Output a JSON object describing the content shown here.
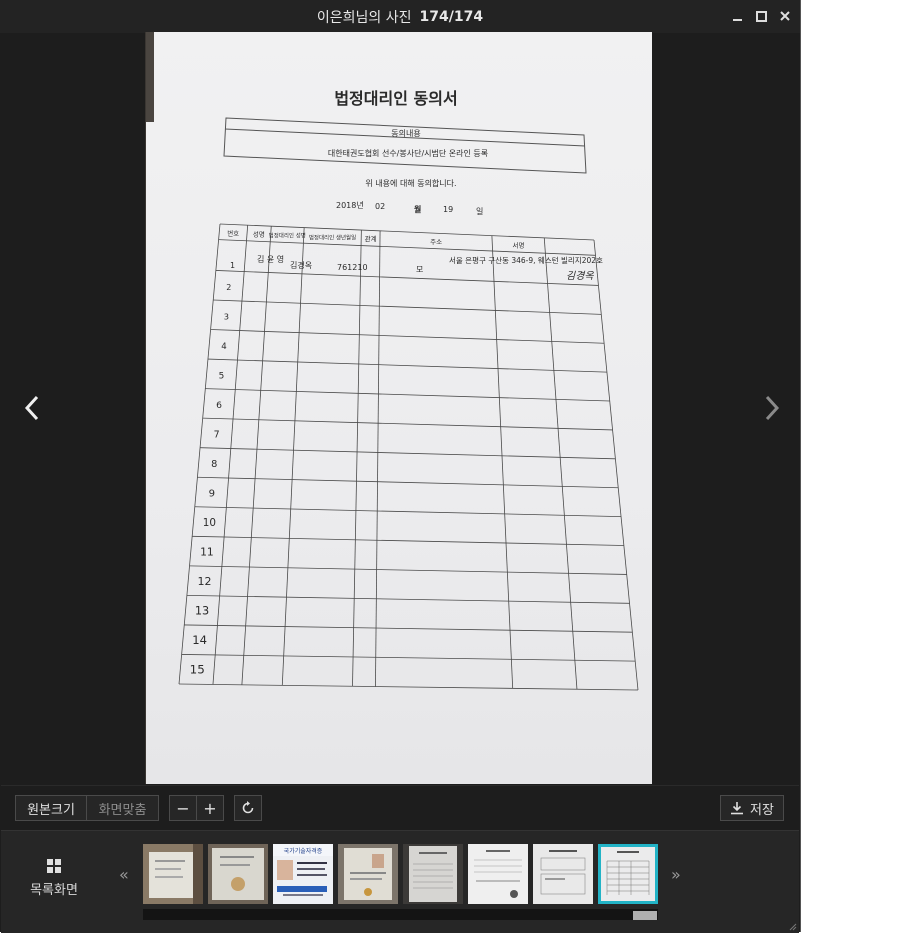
{
  "window": {
    "title": "이은희님의 사진",
    "counter": "174/174",
    "minimize_icon": "minimize-icon",
    "maximize_icon": "maximize-icon",
    "close_icon": "close-icon"
  },
  "document": {
    "heading": "법정대리인 동의서",
    "consent_label": "동의내용",
    "consent_text": "대한태권도협회 선수/봉사단/시범단 온라인 등록",
    "agree_text": "위 내용에 대해 동의합니다.",
    "date_year": "2018년",
    "date_month": "02",
    "date_month_unit": "월",
    "date_day": "19",
    "date_day_unit": "일",
    "table_headers": [
      "번호",
      "성명",
      "법정대리인 성명",
      "법정대리인 생년월일",
      "관계",
      "주소",
      "서명"
    ],
    "row1": {
      "no": "1",
      "name": "김 윤 영",
      "guardian": "김경옥",
      "birth": "761210",
      "relation": "모",
      "address": "서울 은평구 구산동 346-9, 웨스턴 빌리지202호",
      "signature": "김경옥"
    },
    "row_numbers": [
      "2",
      "3",
      "4",
      "5",
      "6",
      "7",
      "8",
      "9",
      "10",
      "11",
      "12",
      "13",
      "14",
      "15"
    ]
  },
  "toolbar": {
    "original_size_label": "원본크기",
    "fit_screen_label": "화면맞춤",
    "zoom_out_label": "−",
    "zoom_in_label": "+",
    "rotate_icon": "rotate-icon",
    "save_label": "저장",
    "save_icon": "download-icon"
  },
  "strip": {
    "list_label": "목록화면",
    "list_icon": "grid-icon",
    "prev_label": "«",
    "next_label": "»",
    "thumbnails": [
      {
        "name": "thumb-1",
        "selected": false
      },
      {
        "name": "thumb-2",
        "selected": false
      },
      {
        "name": "thumb-3",
        "caption": "국가기술자격증",
        "selected": false
      },
      {
        "name": "thumb-4",
        "selected": false
      },
      {
        "name": "thumb-5",
        "selected": false
      },
      {
        "name": "thumb-6",
        "selected": false
      },
      {
        "name": "thumb-7",
        "selected": false
      },
      {
        "name": "thumb-8",
        "selected": true
      }
    ]
  },
  "colors": {
    "background": "#1d1d1d",
    "selected_border": "#22b3c6"
  }
}
